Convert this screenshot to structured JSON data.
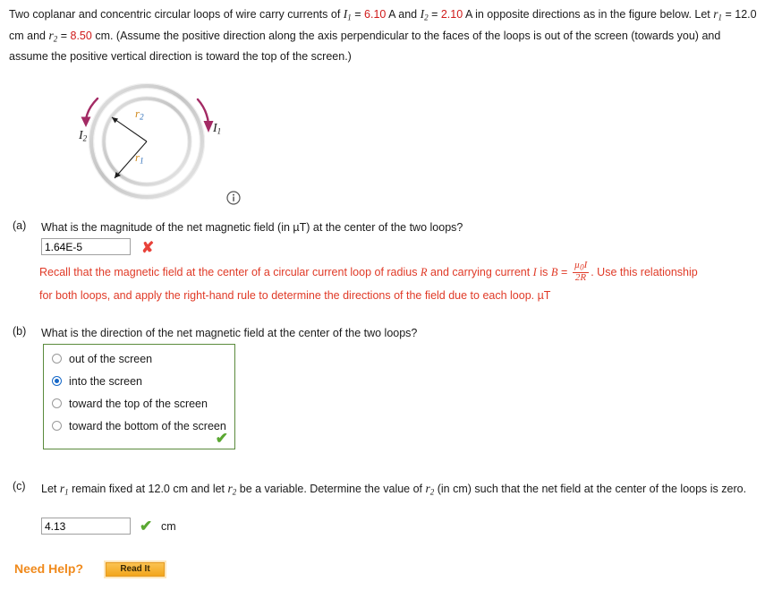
{
  "statement": {
    "line1_a": "Two coplanar and concentric circular loops of wire carry currents of ",
    "I1_sym": "I",
    "I1_sub": "1",
    "eq1": " = ",
    "I1_value": "6.10",
    "unit_A_1": " A and ",
    "I2_sym": "I",
    "I2_sub": "2",
    "eq2": " = ",
    "I2_value": "2.10",
    "tail1": " A in opposite directions as in the figure below. Let ",
    "r1_sym": "r",
    "r1_sub": "1",
    "eq3": " = ",
    "r1_value": "12.0 cm",
    "mid": " and ",
    "r2_sym": "r",
    "r2_sub": "2",
    "eq4": " = ",
    "r2_value": "8.50",
    "tail2": " cm. (Assume the positive direction along the axis perpendicular to the faces of the loops is out of the screen (towards you) and assume the positive vertical direction is toward the top of the screen.)"
  },
  "figure": {
    "label_I1": "I",
    "label_I1_sub": "1",
    "label_I2": "I",
    "label_I2_sub": "2",
    "label_r1": "r",
    "label_r1_sub": "1",
    "label_r2": "r",
    "label_r2_sub": "2",
    "info_icon": "info-icon",
    "colors": {
      "current_arrow": "#a32a64",
      "loop_gray": "#c9c9c9",
      "radius_label": "#d08a20",
      "radius_subscript": "#2b6cb8"
    }
  },
  "part_a": {
    "label": "(a)",
    "question": "What is the magnitude of the net magnetic field (in µT) at the center of the two loops?",
    "answer_value": "1.64E-5",
    "mark": "✘",
    "mark_status": "incorrect",
    "hint_before": "Recall that the magnetic field at the center of a circular current loop of radius ",
    "hint_R": "R",
    "hint_mid": " and carrying current ",
    "hint_I": "I",
    "hint_is": " is ",
    "hint_B": "B",
    "hint_eq": " = ",
    "frac_num_mu": "µ",
    "frac_num_sub": "0",
    "frac_num_I": "I",
    "frac_den": "2R",
    "hint_after": ". Use this relationship for both loops, and apply the right-hand rule to determine the directions of the field due to each loop. µT"
  },
  "part_b": {
    "label": "(b)",
    "question": "What is the direction of the net magnetic field at the center of the two loops?",
    "options": [
      {
        "label": "out of the screen",
        "selected": false
      },
      {
        "label": "into the screen",
        "selected": true
      },
      {
        "label": "toward the top of the screen",
        "selected": false
      },
      {
        "label": "toward the bottom of the screen",
        "selected": false
      }
    ],
    "mark": "✔",
    "mark_status": "correct"
  },
  "part_c": {
    "label": "(c)",
    "question_a": "Let ",
    "q_r1": "r",
    "q_r1_sub": "1",
    "question_b": " remain fixed at 12.0 cm and let ",
    "q_r2": "r",
    "q_r2_sub": "2",
    "question_c": " be a variable. Determine the value of ",
    "q_r2b": "r",
    "q_r2b_sub": "2",
    "question_d": " (in cm) such that the net field at the center of the loops is zero.",
    "answer_value": "4.13",
    "mark": "✔",
    "mark_status": "correct",
    "unit": "cm"
  },
  "footer": {
    "need_help_label": "Need Help?",
    "read_it_label": "Read It"
  }
}
